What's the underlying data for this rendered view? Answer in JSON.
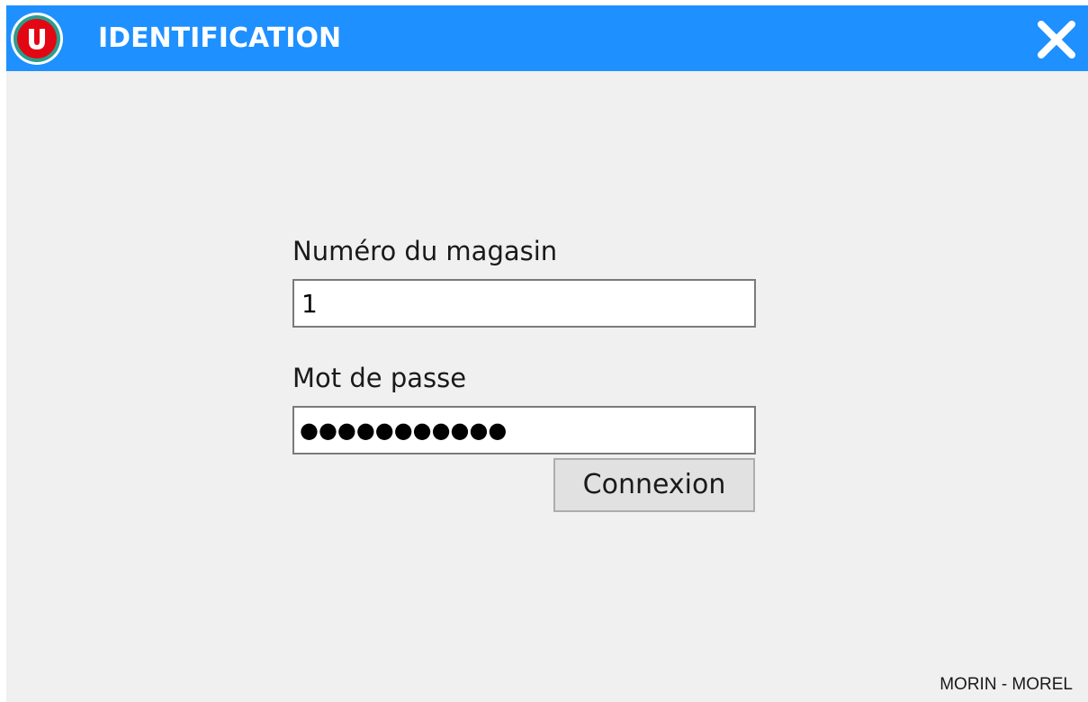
{
  "window": {
    "title": "IDENTIFICATION",
    "logo_letter": "U",
    "close_icon": "close-icon"
  },
  "form": {
    "store_label": "Numéro du magasin",
    "store_value": "1",
    "password_label": "Mot de passe",
    "password_value": "●●●●●●●●●●●",
    "submit_label": "Connexion"
  },
  "footer": {
    "text": "MORIN - MOREL"
  },
  "colors": {
    "titlebar": "#1e90ff",
    "background": "#f0f0f0",
    "logo_red": "#e30613",
    "logo_green": "#2a9d8f"
  }
}
